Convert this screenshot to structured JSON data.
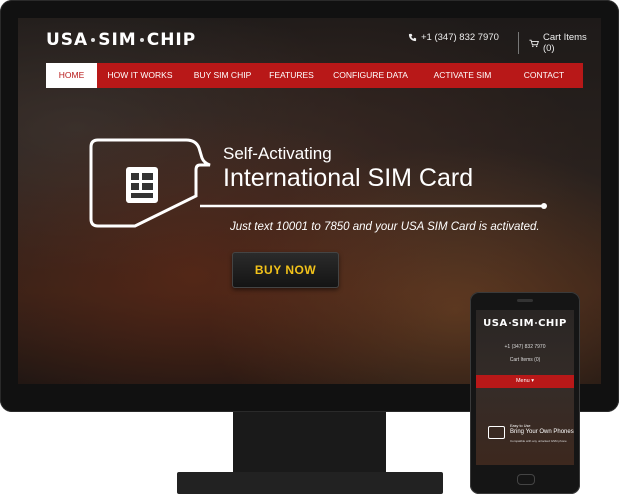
{
  "site": {
    "logo_parts": [
      "USA",
      "SIM",
      "CHIP"
    ],
    "phone": "+1 (347) 832 7970",
    "cart": "Cart Items (0)"
  },
  "nav": {
    "items": [
      {
        "label": "HOME",
        "active": true
      },
      {
        "label": "HOW IT WORKS",
        "active": false
      },
      {
        "label": "BUY SIM CHIP",
        "active": false
      },
      {
        "label": "FEATURES",
        "active": false
      },
      {
        "label": "CONFIGURE DATA",
        "active": false
      },
      {
        "label": "ACTIVATE SIM",
        "active": false
      },
      {
        "label": "CONTACT",
        "active": false
      }
    ]
  },
  "hero": {
    "subtitle": "Self-Activating",
    "title": "International SIM Card",
    "text": "Just text 10001 to 7850 and your USA SIM Card is activated.",
    "button": "BUY NOW"
  },
  "mobile": {
    "logo_parts": [
      "USA",
      "SIM",
      "CHIP"
    ],
    "phone": "+1 (347) 832 7970",
    "cart": "Cart Items (0)",
    "menu": "Menu",
    "hero_subtitle": "Easy to Use",
    "hero_title": "Bring Your Own Phones",
    "hero_text": "Compatible with any unlocked GSM phone"
  },
  "colors": {
    "brand_red": "#b81818",
    "button_text": "#f2c21a",
    "bezel": "#111111"
  },
  "icons": {
    "phone": "phone-icon",
    "cart": "cart-icon",
    "sim": "sim-card-icon",
    "menu_caret": "chevron-down-icon"
  }
}
